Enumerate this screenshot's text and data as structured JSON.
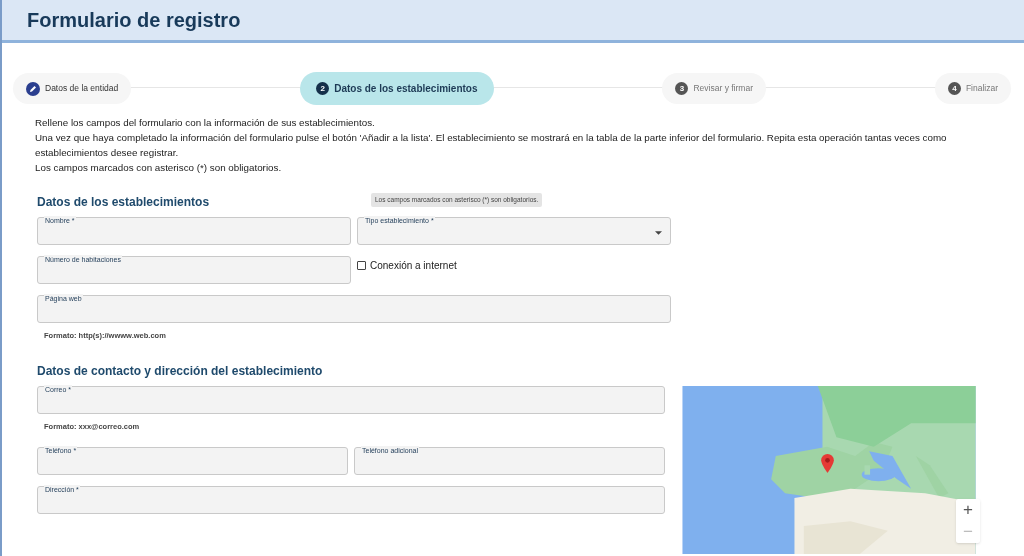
{
  "header": {
    "title": "Formulario de registro"
  },
  "steps": [
    {
      "label": "Datos de la entidad",
      "selected": false,
      "completed": true
    },
    {
      "number": "2",
      "label": "Datos de los establecimientos",
      "selected": true,
      "completed": false
    },
    {
      "number": "3",
      "label": "Revisar y firmar",
      "selected": false,
      "completed": false
    },
    {
      "number": "4",
      "label": "Finalizar",
      "selected": false,
      "completed": false
    }
  ],
  "intro": [
    "Rellene los campos del formulario con la información de sus establecimientos.",
    "Una vez que haya completado la información del formulario pulse el botón 'Añadir a la lista'. El establecimiento se mostrará en la tabla de la parte inferior del formulario. Repita esta operación tantas veces como establecimientos desee registrar.",
    "Los campos marcados con asterisco (*) son obligatorios."
  ],
  "tooltip": "Los campos marcados con asterisco (*) son obligatorios.",
  "sections": [
    {
      "title": "Datos de los establecimientos",
      "rows": [
        [
          {
            "kind": "text",
            "label": "Nombre *"
          },
          {
            "kind": "select",
            "label": "Tipo establecimiento *"
          }
        ],
        [
          {
            "kind": "text",
            "label": "Número de habitaciones"
          },
          {
            "kind": "checkbox",
            "label": "Conexión a internet",
            "checked": false
          }
        ],
        [
          {
            "kind": "text",
            "label": "Página web",
            "hint": "Formato: http(s)://wwww.web.com"
          }
        ]
      ]
    },
    {
      "title": "Datos de contacto y dirección del establecimiento",
      "map": {
        "zoom_in": "+",
        "zoom_out": "−"
      },
      "rows": [
        [
          {
            "kind": "text",
            "label": "Correo *",
            "hint": "Formato: xxx@correo.com"
          }
        ],
        [
          {
            "kind": "text",
            "label": "Teléfono *"
          },
          {
            "kind": "text",
            "label": "Teléfono adicional"
          }
        ],
        [
          {
            "kind": "text",
            "label": "Dirección *"
          }
        ]
      ]
    }
  ]
}
